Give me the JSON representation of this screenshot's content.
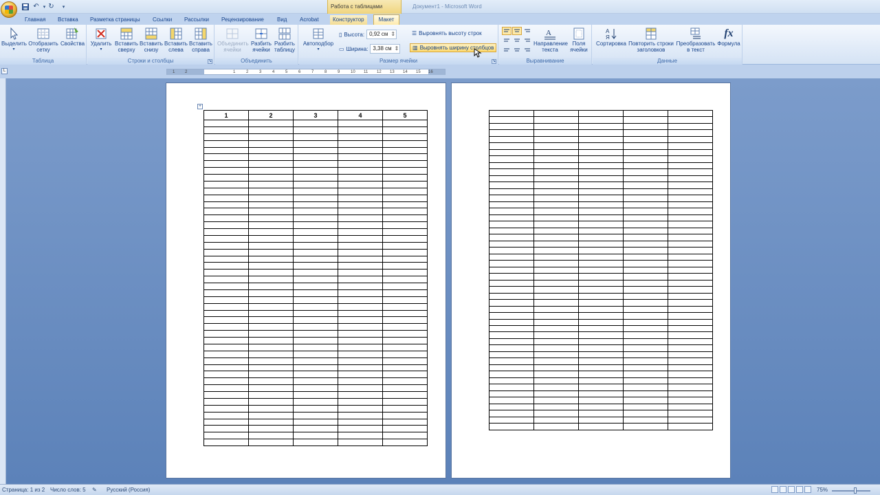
{
  "window": {
    "title": "Документ1 - Microsoft Word",
    "context_group": "Работа с таблицами"
  },
  "quick_access": [
    "save-icon",
    "undo-icon",
    "redo-icon",
    "customize-icon"
  ],
  "tabs": [
    {
      "label": "Главная"
    },
    {
      "label": "Вставка"
    },
    {
      "label": "Разметка страницы"
    },
    {
      "label": "Ссылки"
    },
    {
      "label": "Рассылки"
    },
    {
      "label": "Рецензирование"
    },
    {
      "label": "Вид"
    },
    {
      "label": "Acrobat"
    },
    {
      "label": "Конструктор"
    },
    {
      "label": "Макет"
    }
  ],
  "active_tab": "Макет",
  "ribbon": {
    "table_group": {
      "label": "Таблица",
      "select": "Выделить",
      "gridlines": [
        "Отобразить",
        "сетку"
      ],
      "properties": "Свойства"
    },
    "rows_cols_group": {
      "label": "Строки и столбцы",
      "delete": "Удалить",
      "insert_above": [
        "Вставить",
        "сверху"
      ],
      "insert_below": [
        "Вставить",
        "снизу"
      ],
      "insert_left": [
        "Вставить",
        "слева"
      ],
      "insert_right": [
        "Вставить",
        "справа"
      ]
    },
    "merge_group": {
      "label": "Объединить",
      "merge_cells": [
        "Объединить",
        "ячейки"
      ],
      "split_cells": [
        "Разбить",
        "ячейки"
      ],
      "split_table": [
        "Разбить",
        "таблицу"
      ]
    },
    "cell_size_group": {
      "label": "Размер ячейки",
      "autofit": "Автоподбор",
      "height_label": "Высота:",
      "height_value": "0,92 см",
      "width_label": "Ширина:",
      "width_value": "3,38 см",
      "distribute_rows": "Выровнять высоту строк",
      "distribute_cols": "Выровнять ширину столбцов"
    },
    "alignment_group": {
      "label": "Выравнивание",
      "text_direction": [
        "Направление",
        "текста"
      ],
      "cell_margins": [
        "Поля",
        "ячейки"
      ]
    },
    "data_group": {
      "label": "Данные",
      "sort": "Сортировка",
      "repeat_header": [
        "Повторить строки",
        "заголовков"
      ],
      "convert_text": [
        "Преобразовать",
        "в текст"
      ],
      "formula": "Формула"
    }
  },
  "ruler": {
    "ticks": [
      "1",
      "2",
      "1",
      "2",
      "3",
      "4",
      "5",
      "6",
      "7",
      "8",
      "9",
      "10",
      "11",
      "12",
      "13",
      "14",
      "15",
      "16",
      "17"
    ]
  },
  "table_page1": {
    "header": [
      "1",
      "2",
      "3",
      "4",
      "5"
    ],
    "empty_rows": 48
  },
  "table_page2": {
    "rows": 49,
    "cols": 5
  },
  "statusbar": {
    "page": "Страница: 1 из 2",
    "words": "Число слов: 5",
    "language": "Русский (Россия)",
    "zoom": "75%"
  },
  "colors": {
    "ribbon_bg": "#dfe9f6",
    "workspace_bg": "#6d90bf",
    "context_tab": "#f3dd95",
    "highlight": "#fdd96f"
  }
}
